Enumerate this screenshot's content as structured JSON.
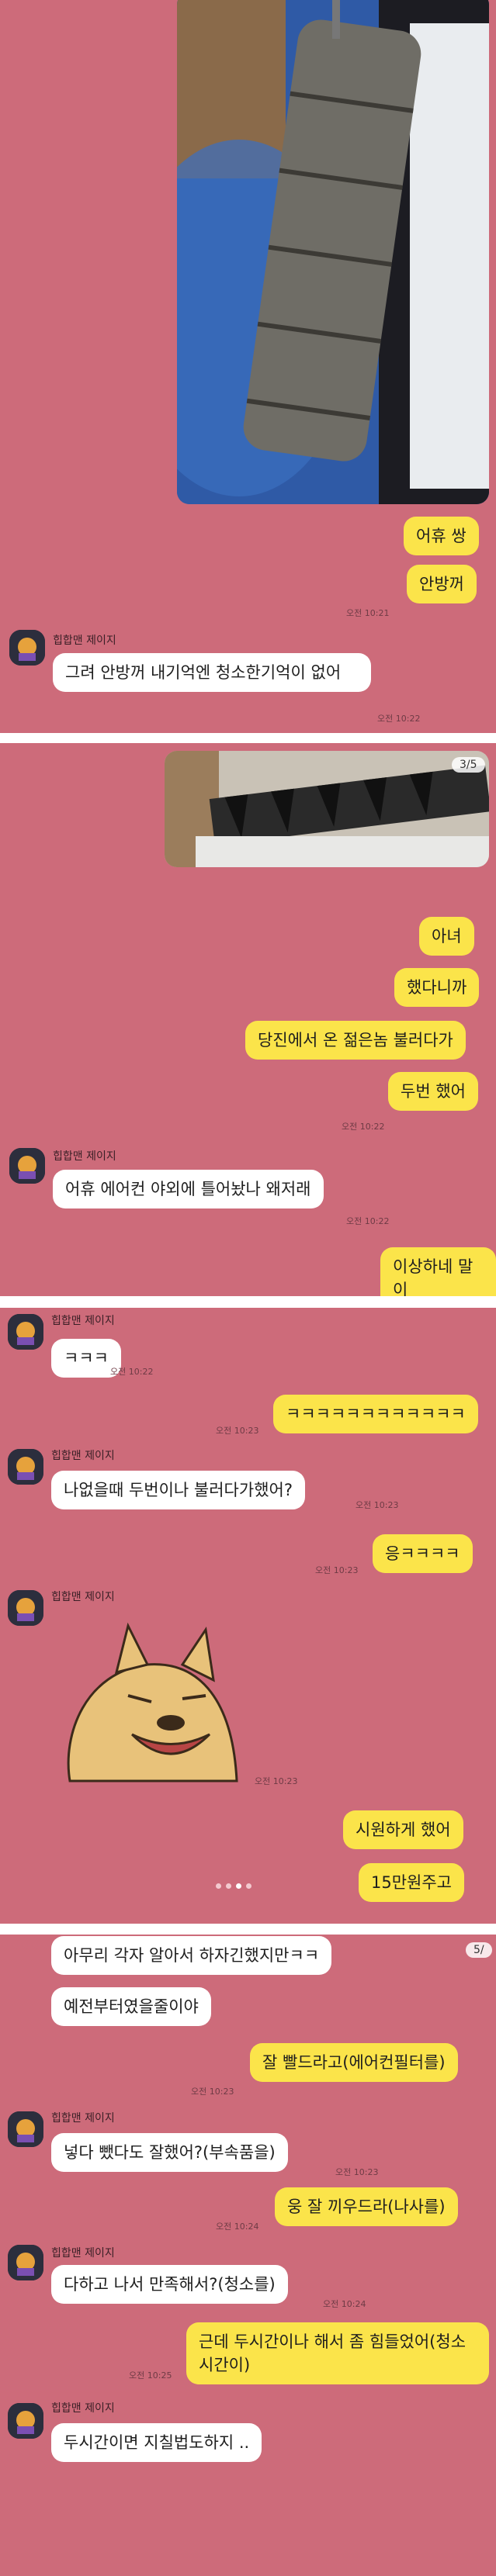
{
  "panel1": {
    "msgs": {
      "m1": "어휴 쌍",
      "m2": "안방꺼"
    },
    "time1": "오전 10:21",
    "sender": "힙합맨 제이지",
    "their": "그려 안방꺼 내기억엔 청소한기억이 없어",
    "time2": "오전 10:22"
  },
  "panel2": {
    "counter": "3/5",
    "msgs": {
      "m1": "아녀",
      "m2": "했다니까",
      "m3": "당진에서 온 젊은놈 불러다가",
      "m4": "두번 했어"
    },
    "time1": "오전 10:22",
    "sender": "힙합맨 제이지",
    "their": "어휴 에어컨 야외에 틀어놨나 왜저래",
    "time2": "오전 10:22",
    "mine_last": "이상하네 말이"
  },
  "panel3": {
    "sender": "힙합맨 제이지",
    "their1": "ㅋㅋㅋ",
    "time1": "오전 10:22",
    "mine1": "ㅋㅋㅋㅋㅋㅋㅋㅋㅋㅋㅋㅋ",
    "time2": "오전 10:23",
    "their2": "나없을때 두번이나 불러다가했어?",
    "time3": "오전 10:23",
    "mine2": "응ㅋㅋㅋㅋ",
    "time4": "오전 10:23",
    "time5": "오전 10:23",
    "mine3": "시원하게 했어",
    "mine4": "15만원주고"
  },
  "panel4": {
    "counter": "5/",
    "their1": "아무리 각자 알아서 하자긴했지만ㅋㅋ",
    "their2": "예전부터였을줄이야",
    "mine1": "잘 빨드라고(에어컨필터를)",
    "time1": "오전 10:23",
    "sender": "힙합맨 제이지",
    "their3": "넣다 뺐다도 잘했어?(부속품을)",
    "time2": "오전 10:23",
    "mine2": "웅 잘 끼우드라(나사를)",
    "time3": "오전 10:24",
    "their4": "다하고 나서 만족해서?(청소를)",
    "time4": "오전 10:24",
    "mine3": "근데 두시간이나 해서 좀 힘들었어(청소시간이)",
    "time5": "오전 10:25",
    "their5": "두시간이면 지칠법도하지 .."
  }
}
